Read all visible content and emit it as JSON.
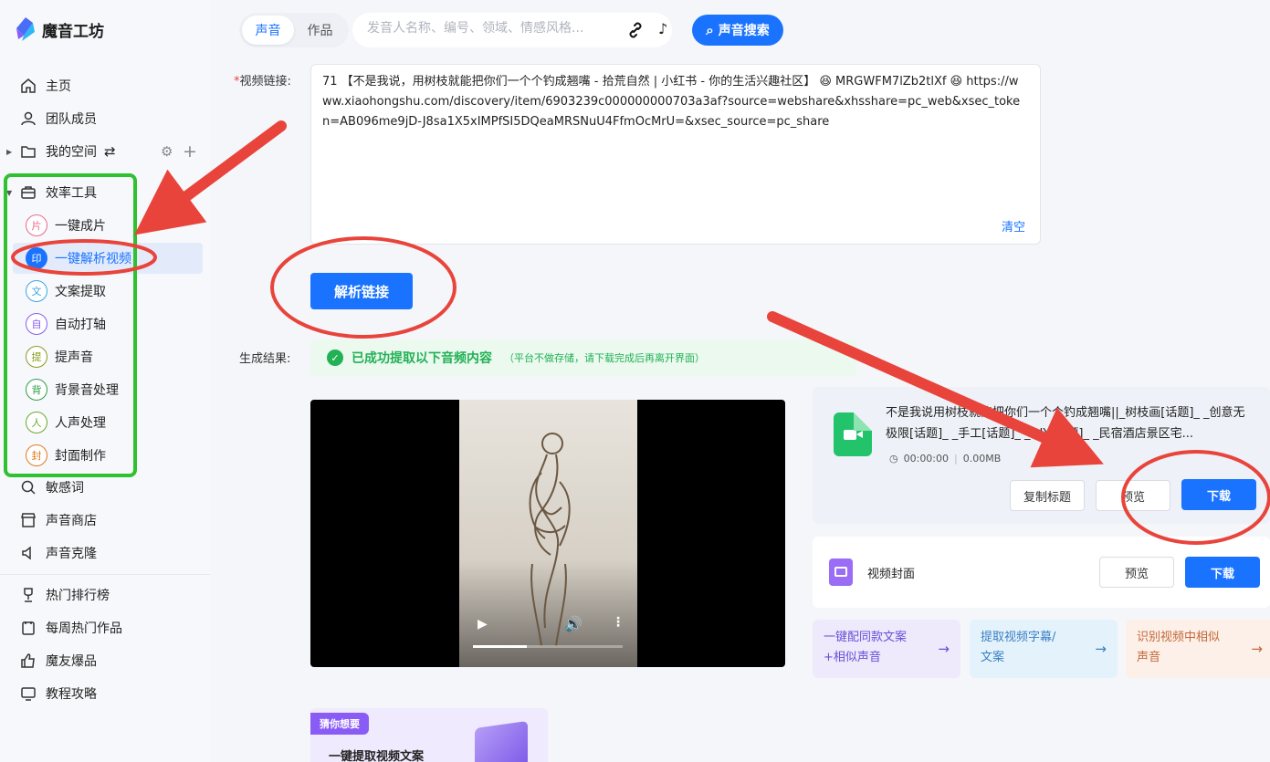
{
  "app": {
    "name": "魔音工坊"
  },
  "sidebar": {
    "items": [
      {
        "label": "主页",
        "icon": "home-icon"
      },
      {
        "label": "团队成员",
        "icon": "user-icon"
      },
      {
        "label": "我的空间",
        "icon": "folder-icon"
      },
      {
        "label": "效率工具",
        "icon": "briefcase-icon"
      }
    ],
    "tools": [
      {
        "label": "一键成片",
        "badge": "片",
        "color": "#e86a8f"
      },
      {
        "label": "一键解析视频",
        "badge": "印",
        "color": "#1a73ff"
      },
      {
        "label": "文案提取",
        "badge": "文",
        "color": "#3aa6e8"
      },
      {
        "label": "自动打轴",
        "badge": "自",
        "color": "#8a5cf6"
      },
      {
        "label": "提声音",
        "badge": "提",
        "color": "#8a9a1e"
      },
      {
        "label": "背景音处理",
        "badge": "背",
        "color": "#2e9e4a"
      },
      {
        "label": "人声处理",
        "badge": "人",
        "color": "#6aa82e"
      },
      {
        "label": "封面制作",
        "badge": "封",
        "color": "#e07a1e"
      }
    ],
    "more": [
      {
        "label": "敏感词",
        "icon": "shield-search-icon"
      },
      {
        "label": "声音商店",
        "icon": "store-icon"
      },
      {
        "label": "声音克隆",
        "icon": "sound-icon"
      }
    ],
    "bottom": [
      {
        "label": "热门排行榜",
        "icon": "trophy-icon"
      },
      {
        "label": "每周热门作品",
        "icon": "calendar-icon"
      },
      {
        "label": "魔友爆品",
        "icon": "thumb-up-icon"
      },
      {
        "label": "教程攻略",
        "icon": "monitor-icon"
      }
    ]
  },
  "search": {
    "tabs": [
      "声音",
      "作品"
    ],
    "placeholder": "发音人名称、编号、领域、情感风格...",
    "button": "声音搜索"
  },
  "form": {
    "link_label": "视频链接:",
    "link_value": "71 【不是我说，用树枝就能把你们一个个钓成翘嘴 - 拾荒自然 | 小红书 - 你的生活兴趣社区】 😆 MRGWFM7lZb2tlXf 😆 https://www.xiaohongshu.com/discovery/item/6903239c000000000703a3af?source=webshare&xhsshare=pc_web&xsec_token=AB096me9jD-J8sa1X5xIMPfSI5DQeaMRSNuU4FfmOcMrU=&xsec_source=pc_share",
    "clear": "清空",
    "parse_button": "解析链接",
    "result_label": "生成结果:"
  },
  "result": {
    "success": "已成功提取以下音频内容",
    "note": "（平台不做存储，请下载完成后再离开界面）",
    "video_progress": 0.36,
    "file": {
      "title": "不是我说用树枝就能把你们一个个钓成翘嘴||_树枝画[话题]_ _创意无极限[话题]_ _手工[话题]_ _DIY[话题]_ _民宿酒店景区宅...",
      "duration": "00:00:00",
      "size": "0.00MB",
      "copy_title": "复制标题",
      "preview": "预览",
      "download": "下载"
    },
    "cover": {
      "label": "视频封面",
      "preview": "预览",
      "download": "下载"
    }
  },
  "features": [
    {
      "line1": "一键配同款文案",
      "line2": "+相似声音",
      "bg": "#eeeafc",
      "color": "#6a4ed8"
    },
    {
      "line1": "提取视频字幕/",
      "line2": "文案",
      "bg": "#e4f2fb",
      "color": "#3b7fc4"
    },
    {
      "line1": "识别视频中相似",
      "line2": "声音",
      "bg": "#fdf0e8",
      "color": "#c2683a"
    }
  ],
  "guess": {
    "tag": "猜你想要",
    "text": "一键提取视频文案"
  },
  "colors": {
    "primary": "#1a73ff",
    "success": "#22b155",
    "annotation_red": "#e8443b",
    "annotation_green": "#2fc12f"
  }
}
